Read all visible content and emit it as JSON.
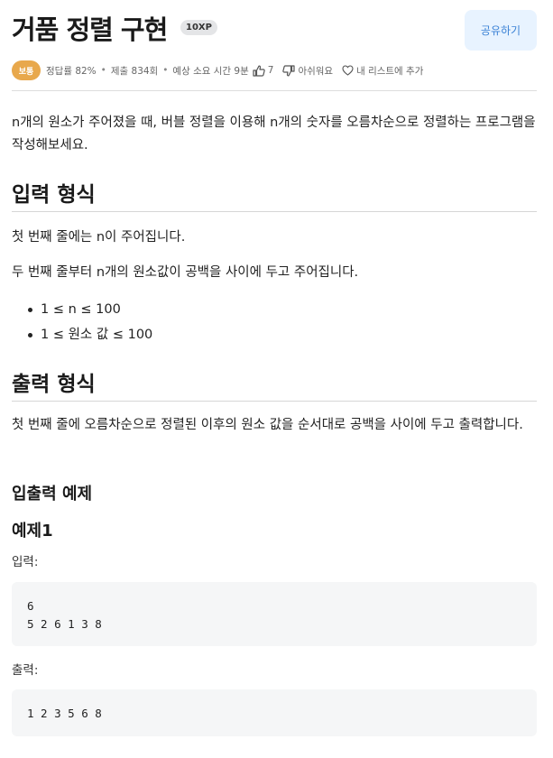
{
  "header": {
    "title": "거품 정렬 구현",
    "xp": "10XP",
    "share_label": "공유하기"
  },
  "meta": {
    "level": "보통",
    "accuracy": "정답률 82%",
    "submissions": "제출 834회",
    "est_time": "예상 소요 시간 9분",
    "likes": "7",
    "dislike_label": "아쉬워요",
    "add_list_label": "내 리스트에 추가",
    "icons": [
      "thumbs-up-icon",
      "thumbs-down-icon",
      "heart-icon"
    ]
  },
  "description": "n개의 원소가 주어졌을 때, 버블 정렬을 이용해 n개의 숫자를 오름차순으로 정렬하는 프로그램을 작성해보세요.",
  "input_section": {
    "heading": "입력 형식",
    "line1": "첫 번째 줄에는 n이 주어집니다.",
    "line2": "두 번째 줄부터 n개의 원소값이 공백을 사이에 두고 주어집니다.",
    "constraints": [
      "1 ≤ n ≤ 100",
      "1 ≤ 원소 값 ≤ 100"
    ]
  },
  "output_section": {
    "heading": "출력 형식",
    "line1": "첫 번째 줄에 오름차순으로 정렬된 이후의 원소 값을 순서대로 공백을 사이에 두고 출력합니다."
  },
  "examples": {
    "heading": "입출력 예제",
    "example1": {
      "title": "예제1",
      "input_label": "입력:",
      "input": "6\n5 2 6 1 3 8",
      "output_label": "출력:",
      "output": "1 2 3 5 6 8"
    }
  }
}
